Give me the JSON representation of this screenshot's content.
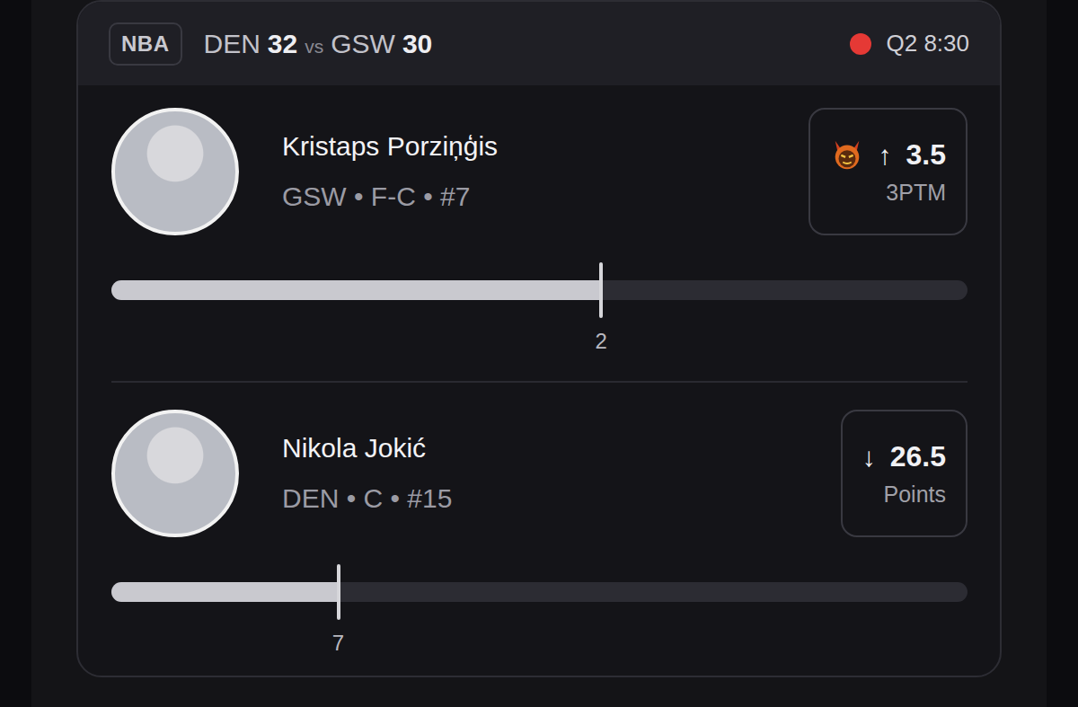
{
  "header": {
    "league": "NBA",
    "team_a": "DEN",
    "score_a": "32",
    "vs": "vs",
    "team_b": "GSW",
    "score_b": "30",
    "live": true,
    "clock": "Q2 8:30"
  },
  "players": [
    {
      "name": "Kristaps Porziņģis",
      "info": "GSW • F-C • #7",
      "demon": true,
      "arrow": "↑",
      "line": "3.5",
      "stat": "3PTM",
      "level": 0.572,
      "reading": "2"
    },
    {
      "name": "Nikola Jokić",
      "info": "DEN • C • #15",
      "demon": false,
      "arrow": "↓",
      "line": "26.5",
      "stat": "Points",
      "level": 0.265,
      "reading": "7"
    }
  ]
}
